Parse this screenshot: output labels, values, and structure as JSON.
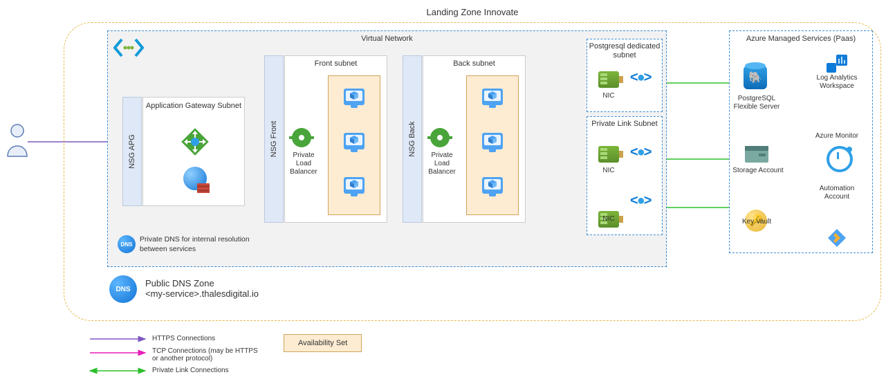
{
  "title": "Landing Zone Innovate",
  "vnet": {
    "title": "Virtual Network"
  },
  "appgw": {
    "title": "Application Gateway Subnet"
  },
  "nsg": {
    "apg": "NSG APG",
    "front": "NSG Front",
    "back": "NSG Back"
  },
  "subnets": {
    "front": "Front subnet",
    "back": "Back subnet",
    "pg": "Postgresql dedicated subnet",
    "pl": "Private Link Subnet"
  },
  "plb": {
    "label": "Private Load Balancer"
  },
  "nic": {
    "label": "NIC"
  },
  "paas": {
    "title": "Azure Managed Services (Paas)",
    "postgres": "PostgreSQL Flexible Server",
    "log": "Log Analytics Workspace",
    "monitor": "Azure Monitor",
    "storage": "Storage Account",
    "automation": "Automation Account",
    "keyvault": "Key Vault"
  },
  "dns": {
    "private": "Private DNS for internal resolution between services",
    "public_label": "Public DNS Zone",
    "public_value": "<my-service>.thalesdigital.io",
    "badge": "DNS"
  },
  "legend": {
    "https": "HTTPS Connections",
    "tcp": "TCP Connections (may be HTTPS or another protocol)",
    "pl": "Private Link Connections",
    "avail": "Availability Set"
  }
}
